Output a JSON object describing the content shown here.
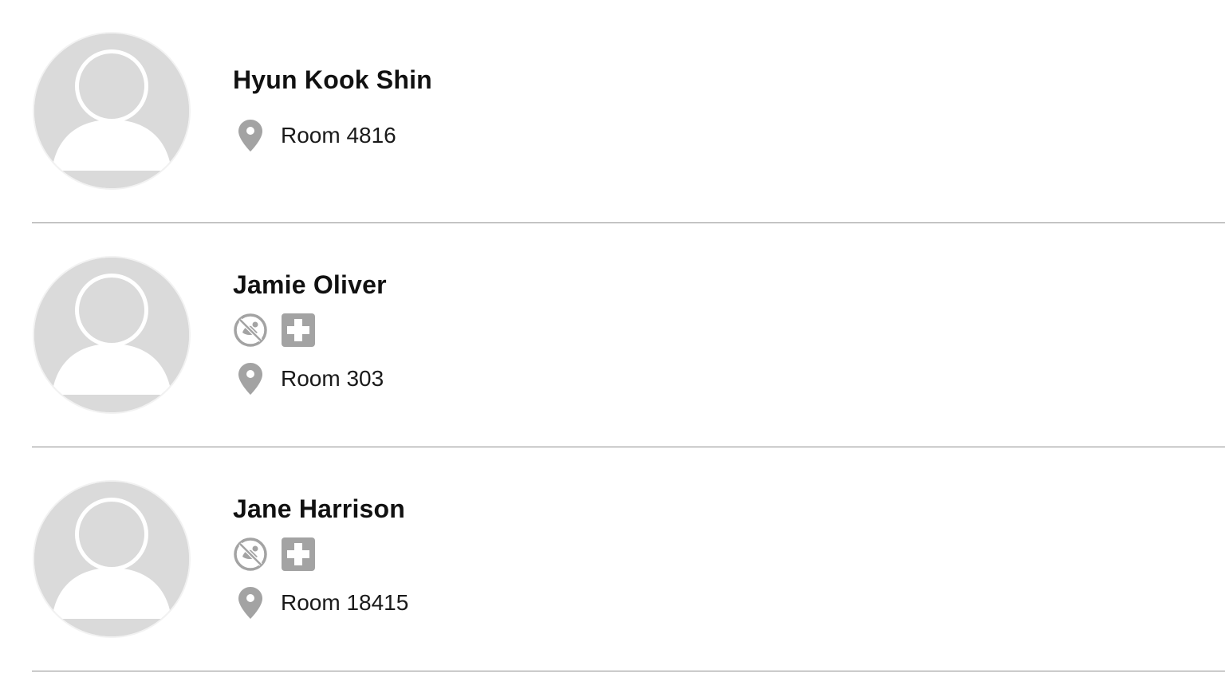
{
  "residents": [
    {
      "name": "Hyun Kook Shin",
      "room": "Room 4816",
      "badges": [],
      "avatar_icon": "default-avatar-icon",
      "location_icon": "map-pin-icon"
    },
    {
      "name": "Jamie Oliver",
      "room": "Room 303",
      "badges": [
        "no-food-icon",
        "medical-cross-icon"
      ],
      "avatar_icon": "default-avatar-icon",
      "location_icon": "map-pin-icon"
    },
    {
      "name": "Jane Harrison",
      "room": "Room 18415",
      "badges": [
        "no-food-icon",
        "medical-cross-icon"
      ],
      "avatar_icon": "default-avatar-icon",
      "location_icon": "map-pin-icon"
    }
  ],
  "colors": {
    "avatar_bg": "#dadada",
    "avatar_fg": "#ffffff",
    "icon_gray": "#a3a3a3",
    "divider": "#8e8e8e",
    "name_text": "#111111",
    "room_text": "#1a1a1a"
  }
}
